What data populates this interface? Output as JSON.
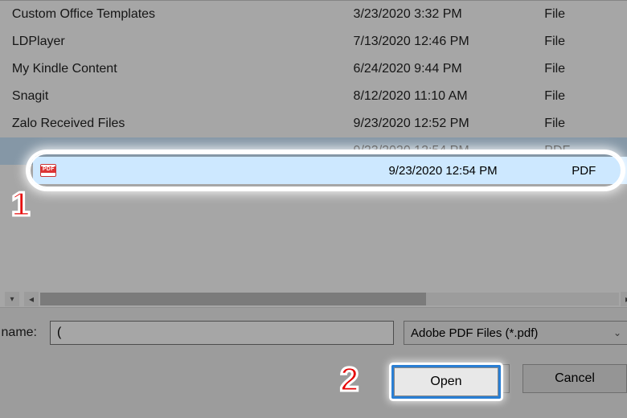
{
  "files": [
    {
      "name": "Custom Office Templates",
      "date": "3/23/2020 3:32 PM",
      "type": "File"
    },
    {
      "name": "LDPlayer",
      "date": "7/13/2020 12:46 PM",
      "type": "File"
    },
    {
      "name": "My Kindle Content",
      "date": "6/24/2020 9:44 PM",
      "type": "File"
    },
    {
      "name": "Snagit",
      "date": "8/12/2020 11:10 AM",
      "type": "File"
    },
    {
      "name": "Zalo Received Files",
      "date": "9/23/2020 12:52 PM",
      "type": "File"
    }
  ],
  "selected": {
    "name": "",
    "date": "9/23/2020 12:54 PM",
    "type": "PDF"
  },
  "filename": {
    "label": "name:",
    "value": "("
  },
  "filetype": {
    "label": "Adobe PDF Files (*.pdf)"
  },
  "buttons": {
    "open": "Open",
    "cancel": "Cancel"
  },
  "annotations": {
    "one": "1",
    "two": "2"
  }
}
